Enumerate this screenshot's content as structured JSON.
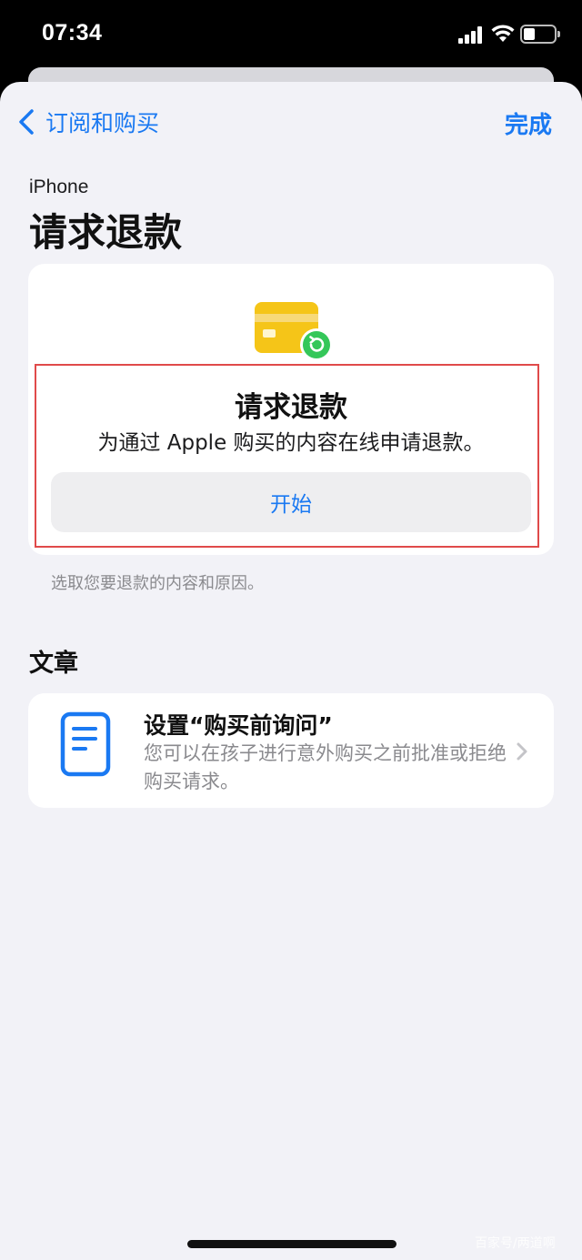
{
  "status_bar": {
    "time": "07:34"
  },
  "nav": {
    "back_label": "订阅和购买",
    "done_label": "完成"
  },
  "header": {
    "eyebrow": "iPhone",
    "title": "请求退款"
  },
  "refund_card": {
    "title": "请求退款",
    "description": "为通过 Apple 购买的内容在线申请退款。",
    "start_button": "开始",
    "icon": "card-refund-icon"
  },
  "footnote": "选取您要退款的内容和原因。",
  "articles_section": {
    "header": "文章",
    "items": [
      {
        "title": "设置“购买前询问”",
        "description": "您可以在孩子进行意外购买之前批准或拒绝购买请求。",
        "icon": "document-icon"
      }
    ]
  },
  "watermark": "百家号/两道啊",
  "colors": {
    "accent": "#1a79f2",
    "sheet_background": "#f2f2f7",
    "card_background": "#ffffff",
    "highlight": "#e04a4a",
    "card_icon_yellow": "#f5c518",
    "refund_green": "#34c759"
  }
}
